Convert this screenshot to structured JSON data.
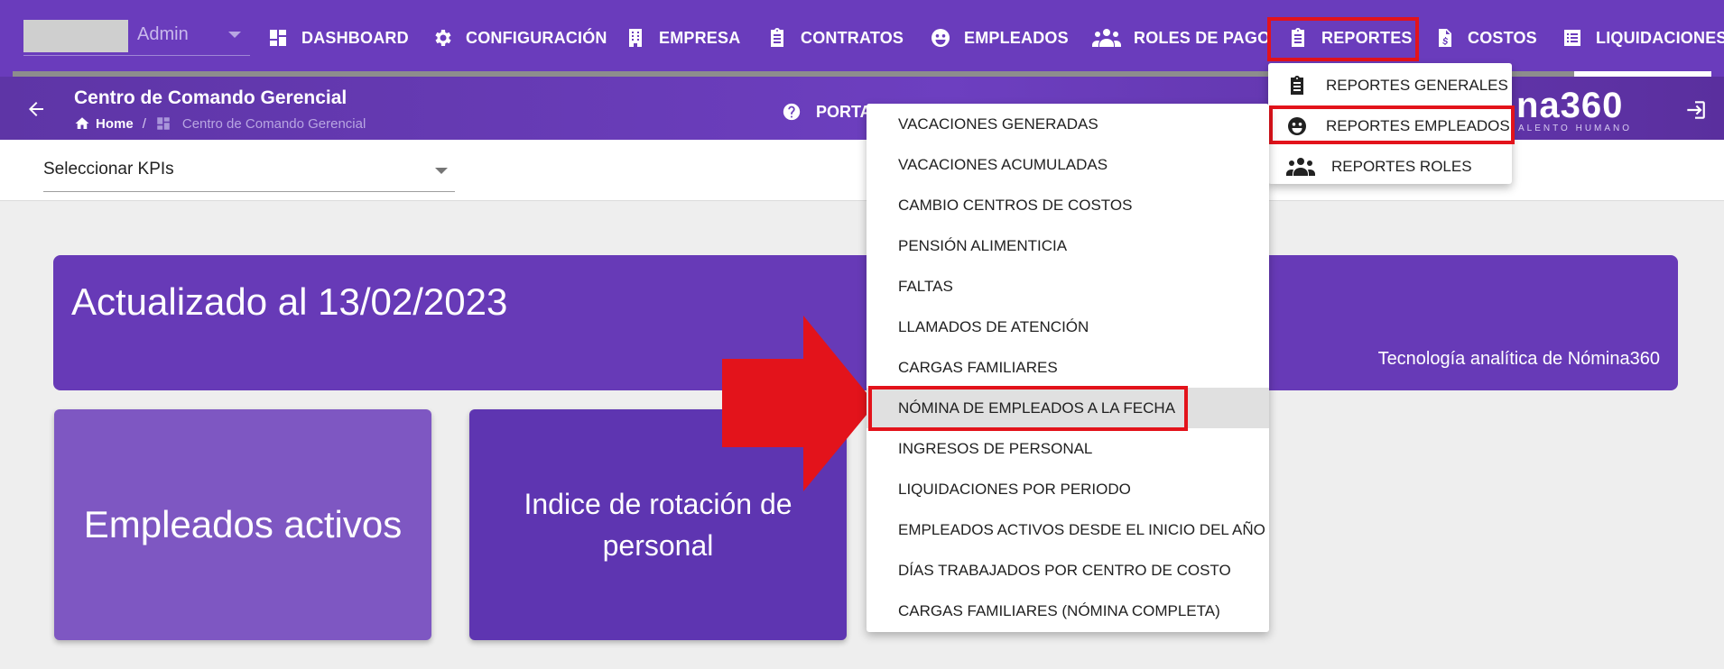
{
  "topnav": {
    "user": "Admin",
    "items": [
      {
        "label": "DASHBOARD",
        "icon": "dashboard-icon"
      },
      {
        "label": "CONFIGURACIÓN",
        "icon": "gear-icon"
      },
      {
        "label": "EMPRESA",
        "icon": "building-icon"
      },
      {
        "label": "CONTRATOS",
        "icon": "clipboard-icon"
      },
      {
        "label": "EMPLEADOS",
        "icon": "face-icon"
      },
      {
        "label": "ROLES DE PAGO",
        "icon": "people-icon"
      },
      {
        "label": "REPORTES",
        "icon": "clipboard-icon"
      },
      {
        "label": "COSTOS",
        "icon": "document-dollar-icon"
      },
      {
        "label": "LIQUIDACIONES",
        "icon": "list-icon"
      }
    ]
  },
  "subheader": {
    "title": "Centro de Comando Gerencial",
    "breadcrumb": {
      "home": "Home",
      "separator": "/",
      "current": "Centro de Comando Gerencial"
    },
    "portal": "PORTA",
    "logo": "na360",
    "logo_sub": "ALENTO HUMANO"
  },
  "filter": {
    "kpi_placeholder": "Seleccionar KPIs"
  },
  "banner": {
    "title": "Actualizado al 13/02/2023",
    "subtitle": "Tecnología analítica de Nómina360"
  },
  "cards": [
    {
      "label": "Empleados activos"
    },
    {
      "label": "Indice de rotación de personal"
    }
  ],
  "reportes_menu": [
    {
      "label": "REPORTES GENERALES",
      "icon": "clipboard-icon"
    },
    {
      "label": "REPORTES EMPLEADOS",
      "icon": "face-icon"
    },
    {
      "label": "REPORTES ROLES",
      "icon": "people-icon"
    }
  ],
  "empleados_menu": [
    "VACACIONES GENERADAS",
    "VACACIONES ACUMULADAS",
    "CAMBIO CENTROS DE COSTOS",
    "PENSIÓN ALIMENTICIA",
    "FALTAS",
    "LLAMADOS DE ATENCIÓN",
    "CARGAS FAMILIARES",
    "NÓMINA DE EMPLEADOS A LA FECHA",
    "INGRESOS DE PERSONAL",
    "LIQUIDACIONES POR PERIODO",
    "EMPLEADOS ACTIVOS DESDE EL INICIO DEL AÑO",
    "DÍAS TRABAJADOS POR CENTRO DE COSTO",
    "CARGAS FAMILIARES (NÓMINA COMPLETA)"
  ],
  "colors": {
    "nav_bg": "#6a3cbc",
    "highlight_red": "#e3131b",
    "banner": "#673ab7",
    "card_light": "#7e57c2",
    "card_dark": "#5e35b1"
  }
}
